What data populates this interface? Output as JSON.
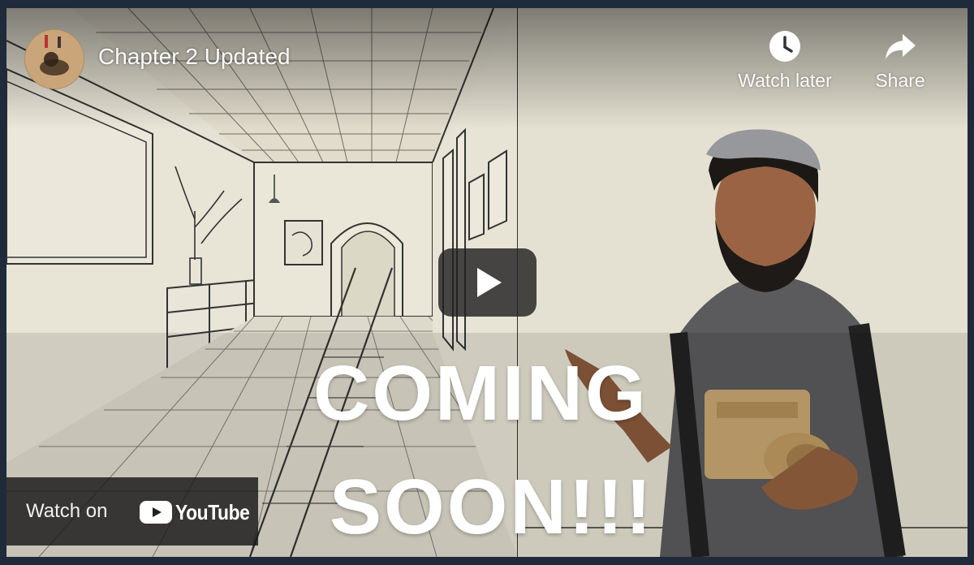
{
  "video": {
    "title": "Chapter 2 Updated",
    "channel_avatar_icon": "channel-avatar-image"
  },
  "actions": {
    "watch_later": {
      "label": "Watch later",
      "icon": "clock-icon"
    },
    "share": {
      "label": "Share",
      "icon": "share-arrow-icon"
    }
  },
  "player": {
    "play_icon": "play-icon"
  },
  "overlay_text": {
    "line1": "COMING",
    "line2": "SOON!!!"
  },
  "branding": {
    "watch_on_label": "Watch on",
    "logo_text": "YouTube",
    "logo_red": "#ff0000"
  }
}
